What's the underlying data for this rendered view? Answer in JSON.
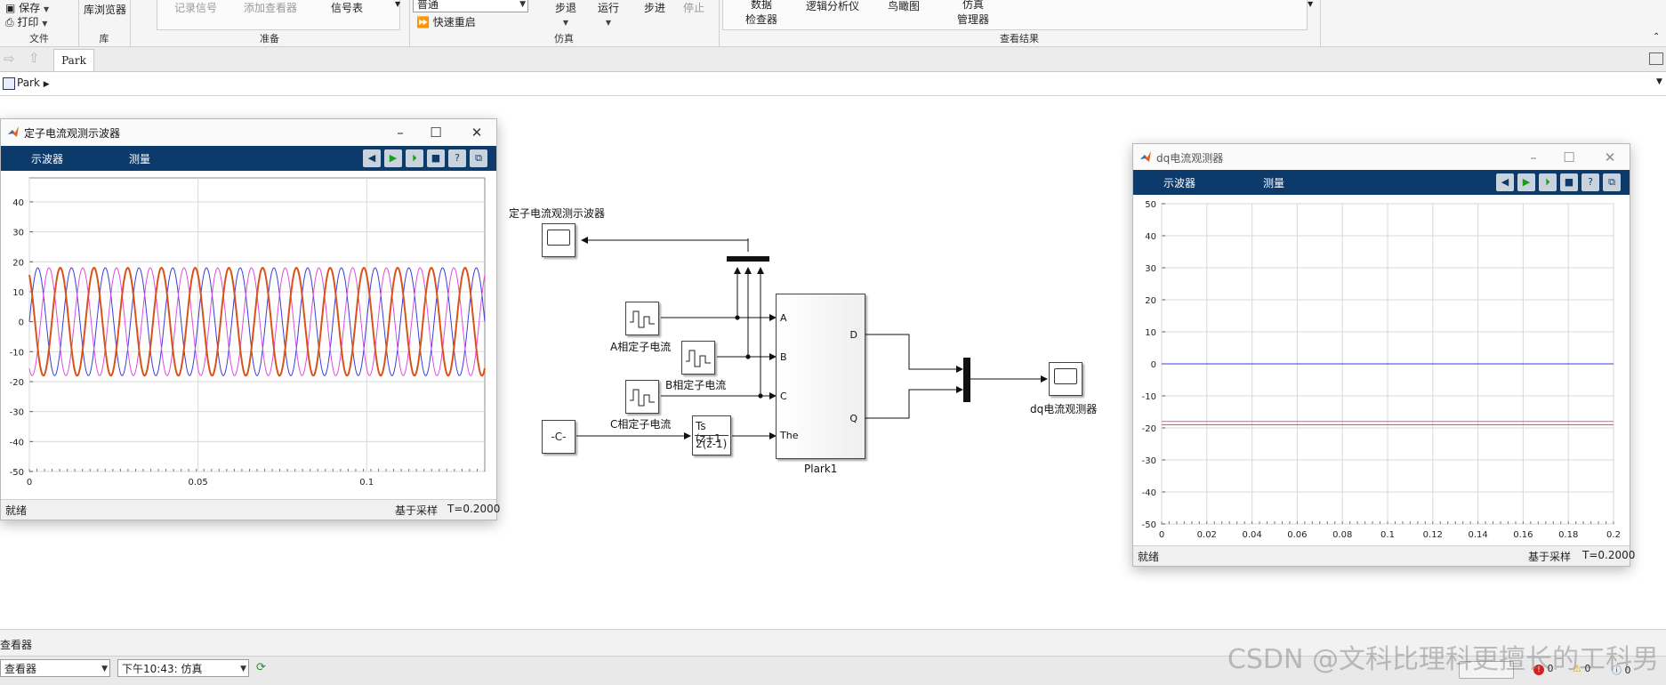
{
  "ribbon": {
    "file": {
      "save": "保存",
      "print": "打印",
      "section": "文件"
    },
    "library": {
      "browser": "库浏览器",
      "section": "库"
    },
    "prepare": {
      "record_signal": "记录信号",
      "add_viewer": "添加查看器",
      "signal_table": "信号表",
      "section": "准备"
    },
    "simulate": {
      "mode_value": "普通",
      "fast_restart": "快速重启",
      "step_back": "步退",
      "run": "运行",
      "step_forward": "步进",
      "stop": "停止",
      "section": "仿真"
    },
    "review": {
      "data_inspector_1": "数据",
      "data_inspector_2": "检查器",
      "logic_analyzer": "逻辑分析仪",
      "bird_eye": "鸟瞰图",
      "sim_manager_1": "仿真",
      "sim_manager_2": "管理器",
      "section": "查看结果"
    }
  },
  "tabs": [
    {
      "label": "Park"
    }
  ],
  "address": {
    "crumb": "Park"
  },
  "scope1": {
    "title": "定子电流观测示波器",
    "menu": [
      "示波器",
      "测量"
    ],
    "status_left": "就绪",
    "status_mode": "基于采样",
    "status_time": "T=0.2000",
    "yticks": [
      "40",
      "30",
      "20",
      "10",
      "0",
      "-10",
      "-20",
      "-30",
      "-40",
      "-50"
    ],
    "xticks": [
      "0",
      "0.05",
      "0.1"
    ]
  },
  "scope2": {
    "title": "dq电流观测器",
    "menu": [
      "示波器",
      "测量"
    ],
    "status_left": "就绪",
    "status_mode": "基于采样",
    "status_time": "T=0.2000",
    "yticks": [
      "50",
      "40",
      "30",
      "20",
      "10",
      "0",
      "-10",
      "-20",
      "-30",
      "-40",
      "-50"
    ],
    "xticks": [
      "0",
      "0.02",
      "0.04",
      "0.06",
      "0.08",
      "0.1",
      "0.12",
      "0.14",
      "0.16",
      "0.18",
      "0.2"
    ]
  },
  "model": {
    "scope_label": "定子电流观测示波器",
    "src_a_label": "A相定子电流",
    "src_b_label": "B相定子电流",
    "src_c_label": "C相定子电流",
    "const_label": "-C-",
    "tf_num": "Ts (z+1",
    "tf_den": "2(z-1)",
    "park_name": "Plark1",
    "park_ports_in": [
      "A",
      "B",
      "C",
      "The"
    ],
    "park_ports_out": [
      "D",
      "Q"
    ],
    "dq_scope_label": "dq电流观测器"
  },
  "bottom": {
    "viewer_label": "查看器",
    "combo1": "查看器",
    "combo2": "下午10:43: 仿真",
    "diag_errors": "0",
    "diag_warnings": "0",
    "diag_info": "0"
  },
  "watermark": "CSDN @文科比理科更擅长的工科男",
  "chart_data": [
    {
      "type": "line",
      "title": "定子电流观测示波器",
      "xlim": [
        0,
        0.135
      ],
      "ylim": [
        -50,
        48
      ],
      "series": [
        {
          "color": "#3b3bdf",
          "amplitude": 18,
          "frequency_hz": 100,
          "phase_deg": 0
        },
        {
          "color": "#e04ce0",
          "amplitude": 18,
          "frequency_hz": 100,
          "phase_deg": -120
        },
        {
          "color": "#d95319",
          "amplitude": 18,
          "frequency_hz": 100,
          "phase_deg": 120
        }
      ]
    },
    {
      "type": "line",
      "title": "dq电流观测器",
      "xlim": [
        0,
        0.2
      ],
      "ylim": [
        -50,
        50
      ],
      "series": [
        {
          "color": "#3b3bdf",
          "x": [
            0,
            0.2
          ],
          "y": [
            0,
            0
          ]
        },
        {
          "color": "#e04ce0",
          "x": [
            0,
            0.2
          ],
          "y": [
            -18,
            -18
          ]
        },
        {
          "color": "#d95319",
          "x": [
            0,
            0.2
          ],
          "y": [
            -19,
            -19
          ]
        }
      ]
    }
  ]
}
